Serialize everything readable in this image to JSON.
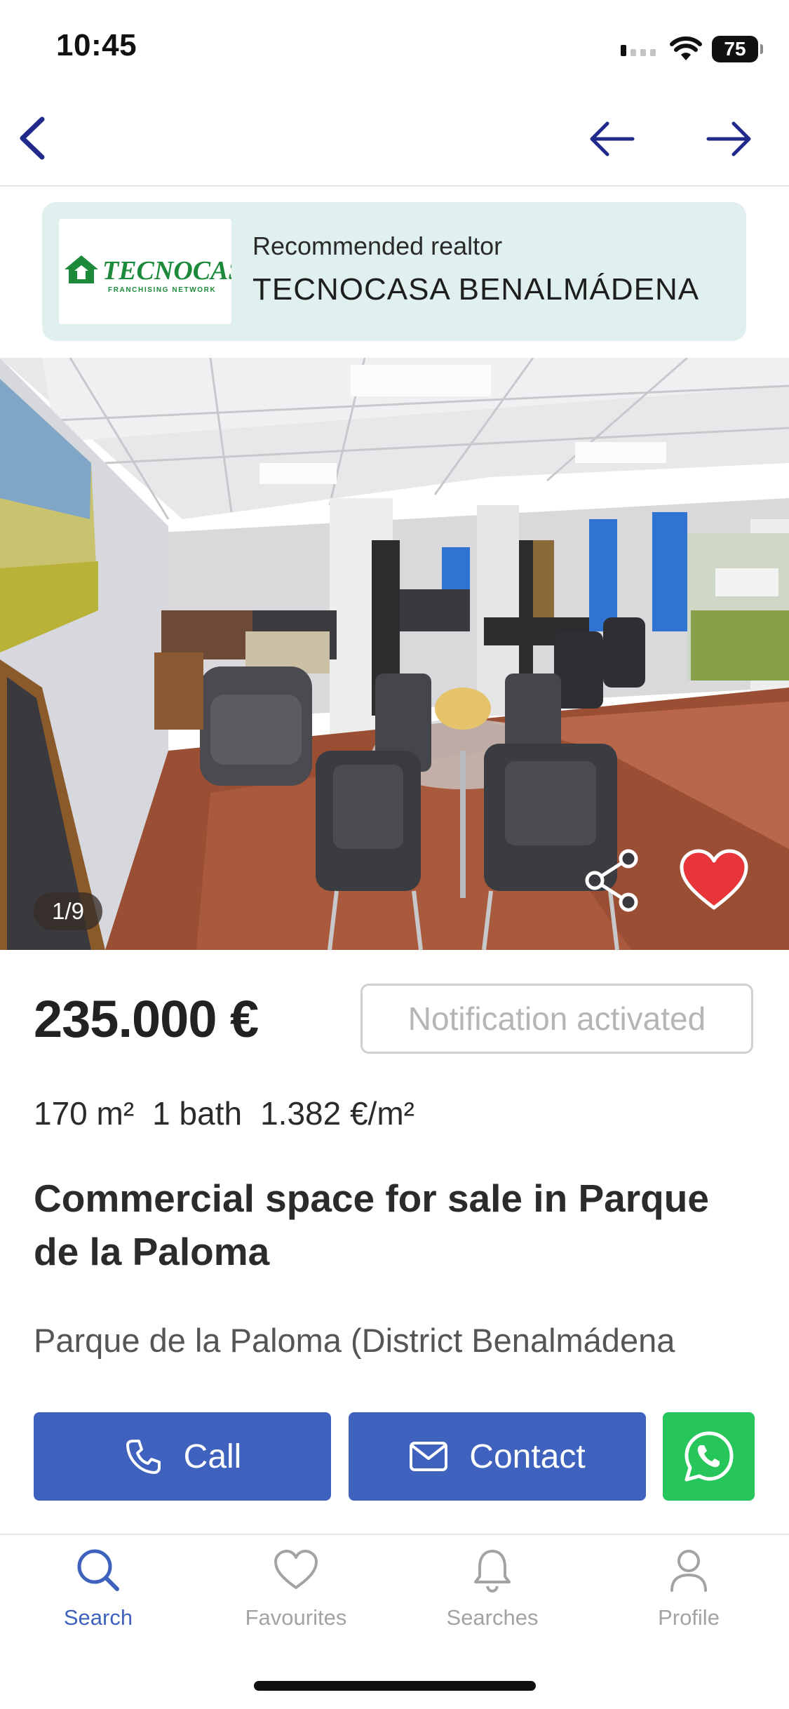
{
  "status_bar": {
    "time": "10:45",
    "battery": "75"
  },
  "realtor": {
    "kicker": "Recommended realtor",
    "name": "TECNOCASA BENALMÁDENA",
    "logo_text": "TECNOCASA",
    "logo_subtext": "FRANCHISING NETWORK"
  },
  "photo": {
    "counter": "1/9"
  },
  "listing": {
    "price": "235.000 €",
    "notification_label": "Notification activated",
    "specs": [
      "170 m²",
      "1 bath",
      "1.382 €/m²"
    ],
    "title": "Commercial space for sale in Parque de la Paloma",
    "address": "Parque de la Paloma (District Benalmádena Costa, Benalmádena)"
  },
  "actions": {
    "call": "Call",
    "contact": "Contact"
  },
  "tabs": [
    {
      "label": "Search",
      "icon": "search-icon",
      "active": true
    },
    {
      "label": "Favourites",
      "icon": "heart-outline-icon",
      "active": false
    },
    {
      "label": "Searches",
      "icon": "bell-icon",
      "active": false
    },
    {
      "label": "Profile",
      "icon": "person-icon",
      "active": false
    }
  ],
  "colors": {
    "primary": "#3e62bd",
    "whatsapp": "#26c65a",
    "favourite": "#e8353a",
    "realtor_bg": "#dff0ef",
    "nav_icons": "#1f2a8a"
  }
}
